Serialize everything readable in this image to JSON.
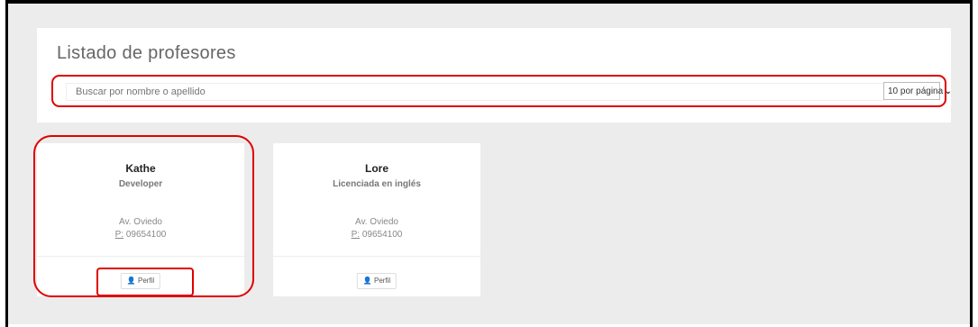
{
  "header": {
    "title": "Listado de profesores"
  },
  "search": {
    "placeholder": "Buscar por nombre o apellido"
  },
  "pagination": {
    "per_page_label": "10 por página"
  },
  "teachers": [
    {
      "name": "Kathe",
      "role": "Developer",
      "address": "Av. Oviedo",
      "phone_prefix": "P:",
      "phone": "09654100",
      "profile_label": "Perfil"
    },
    {
      "name": "Lore",
      "role": "Licenciada en inglés",
      "address": "Av. Oviedo",
      "phone_prefix": "P:",
      "phone": "09654100",
      "profile_label": "Perfil"
    }
  ],
  "colors": {
    "highlight": "#e00000",
    "background": "#ececec",
    "card": "#ffffff"
  },
  "icons": {
    "profile": "user-icon",
    "dropdown": "chevron-down-icon"
  }
}
